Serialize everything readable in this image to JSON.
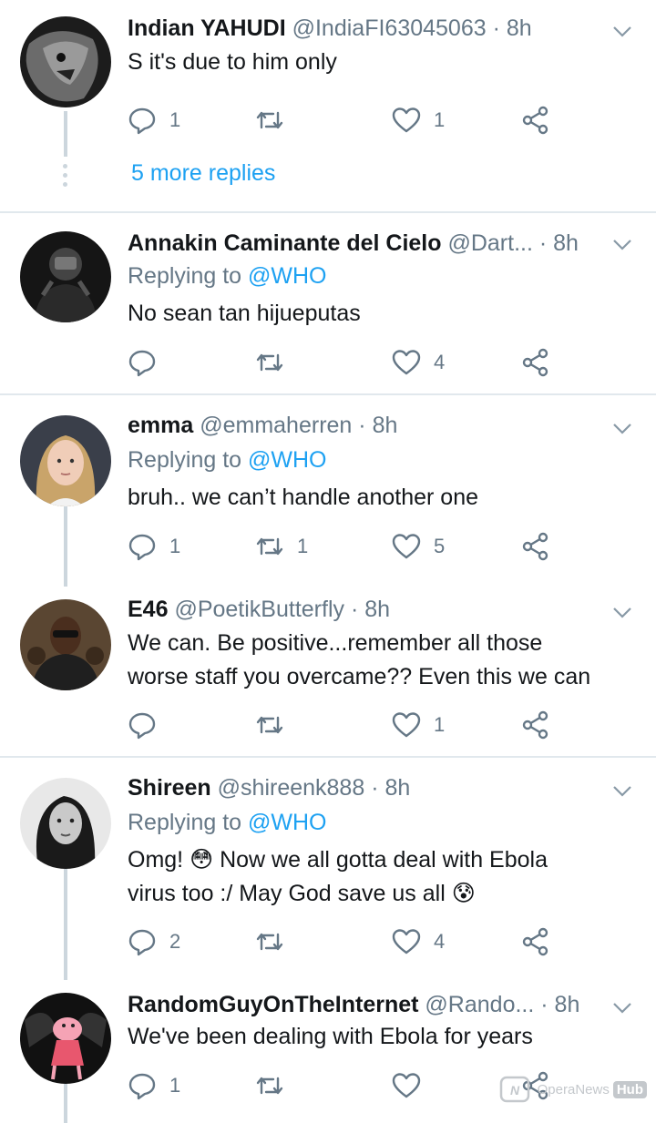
{
  "colors": {
    "link": "#1da1f2",
    "secondary_text": "#657786",
    "divider": "#e1e8ed",
    "thread_line": "#ccd6dd"
  },
  "tweets": [
    {
      "name": "Indian YAHUDI",
      "handle": "@IndiaFI63045063",
      "time": "8h",
      "replying_to": null,
      "text": "S it's due to him only",
      "reply_count": "1",
      "retweet_count": "",
      "like_count": "1",
      "more_replies": "5 more replies"
    },
    {
      "name": "Annakin Caminante del Cielo",
      "handle": "@Dart...",
      "time": "8h",
      "replying_to_prefix": "Replying to",
      "replying_to": "@WHO",
      "text": "No sean tan hijueputas",
      "reply_count": "",
      "retweet_count": "",
      "like_count": "4"
    },
    {
      "name": "emma",
      "handle": "@emmaherren",
      "time": "8h",
      "replying_to_prefix": "Replying to",
      "replying_to": "@WHO",
      "text": "bruh.. we can’t handle another one",
      "reply_count": "1",
      "retweet_count": "1",
      "like_count": "5"
    },
    {
      "name": "E46",
      "handle": "@PoetikButterfly",
      "time": "8h",
      "replying_to": null,
      "text_line1": "We can. Be positive...remember all those",
      "text_line2": "worse staff you overcame?? Even this we can",
      "reply_count": "",
      "retweet_count": "",
      "like_count": "1"
    },
    {
      "name": "Shireen",
      "handle": "@shireenk888",
      "time": "8h",
      "replying_to_prefix": "Replying to",
      "replying_to": "@WHO",
      "text_line1": "Omg! 😳 Now we all gotta deal with Ebola",
      "text_line2": "virus too :/ May God save us all 😰",
      "reply_count": "2",
      "retweet_count": "",
      "like_count": "4"
    },
    {
      "name": "RandomGuyOnTheInternet",
      "handle": "@Rando...",
      "time": "8h",
      "replying_to": null,
      "text": "We've been dealing with Ebola for years",
      "reply_count": "1",
      "retweet_count": "",
      "like_count": ""
    }
  ],
  "separator": "·",
  "watermark": {
    "text": "OperaNews",
    "badge": "Hub"
  }
}
